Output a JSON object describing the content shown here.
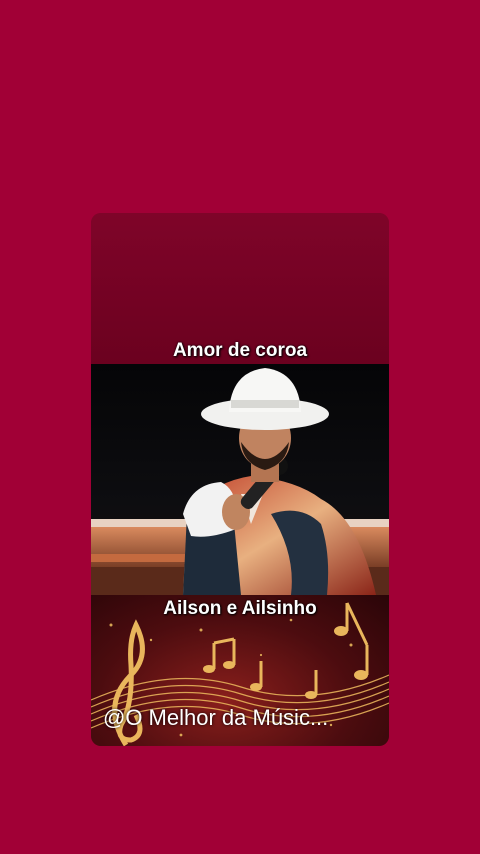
{
  "post": {
    "song_title": "Amor de coroa",
    "artist": "Ailson e Ailsinho",
    "watermark": "@O Melhor da Músic..."
  },
  "colors": {
    "background": "#a10036",
    "card_top": "#7f0429",
    "text": "#ffffff"
  }
}
